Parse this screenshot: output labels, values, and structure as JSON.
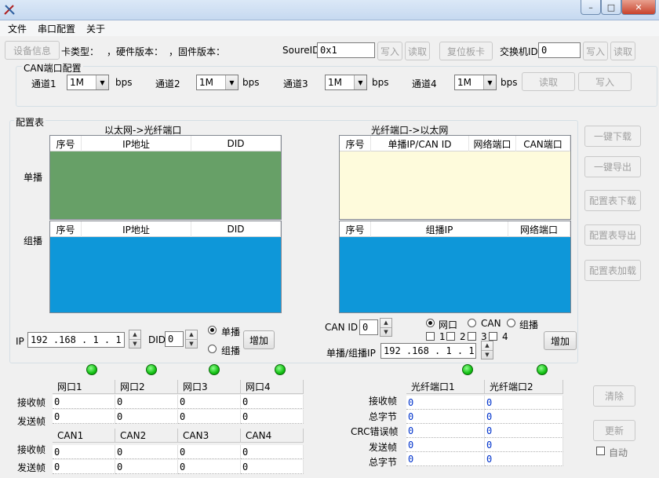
{
  "menu": [
    "文件",
    "串口配置",
    "关于"
  ],
  "device_info_button": "设备信息",
  "card_type_label": "卡类型：",
  "hw_version_label": "，硬件版本：",
  "fw_version_label": "，固件版本：",
  "source_id": {
    "label": "SoureID",
    "value": "0x1",
    "write": "写入",
    "read": "读取"
  },
  "reset_button": "复位板卡",
  "switch_id": {
    "label": "交换机ID",
    "value": "0",
    "write": "写入",
    "read": "读取"
  },
  "can_config": {
    "title": "CAN端口配置",
    "channels": [
      {
        "label": "通道1",
        "value": "1M",
        "unit": "bps"
      },
      {
        "label": "通道2",
        "value": "1M",
        "unit": "bps"
      },
      {
        "label": "通道3",
        "value": "1M",
        "unit": "bps"
      },
      {
        "label": "通道4",
        "value": "1M",
        "unit": "bps"
      }
    ],
    "read": "读取",
    "write": "写入"
  },
  "config_table": {
    "title": "配置表",
    "left_title": "以太网->光纤端口",
    "right_title": "光纤端口->以太网",
    "unicast_label": "单播",
    "multicast_label": "组播",
    "left_unicast_headers": [
      "序号",
      "IP地址",
      "DID"
    ],
    "left_multicast_headers": [
      "序号",
      "IP地址",
      "DID"
    ],
    "right_unicast_headers": [
      "序号",
      "单播IP/CAN ID",
      "网络端口",
      "CAN端口"
    ],
    "right_multicast_headers": [
      "序号",
      "组播IP",
      "网络端口"
    ],
    "colors": {
      "left_unicast_bg": "#67a067",
      "left_multicast_bg": "#0e97d9",
      "right_unicast_bg": "#fefbdc",
      "right_multicast_bg": "#0e97d9"
    }
  },
  "left_controls": {
    "ip_label": "IP",
    "ip_value": "192 .168 .  1  .  1",
    "did_label": "DID",
    "did_value": "0",
    "radio_unicast": "单播",
    "radio_multicast": "组播",
    "add": "增加"
  },
  "right_controls": {
    "can_id_label": "CAN ID",
    "can_id_value": "0",
    "radio_net": "网口",
    "radio_can": "CAN",
    "radio_multicast": "组播",
    "checks": [
      "1",
      "2",
      "3",
      "4"
    ],
    "ip_label": "单播/组播IP",
    "ip_value": "192 .168 .  1  .  1",
    "add": "增加"
  },
  "side_buttons": [
    "一键下载",
    "一键导出",
    "配置表下载",
    "配置表导出",
    "配置表加载"
  ],
  "net_stats": {
    "headers": [
      "网口1",
      "网口2",
      "网口3",
      "网口4"
    ],
    "rows": [
      {
        "label": "接收帧",
        "values": [
          "0",
          "0",
          "0",
          "0"
        ]
      },
      {
        "label": "发送帧",
        "values": [
          "0",
          "0",
          "0",
          "0"
        ]
      }
    ]
  },
  "can_stats": {
    "headers": [
      "CAN1",
      "CAN2",
      "CAN3",
      "CAN4"
    ],
    "rows": [
      {
        "label": "接收帧",
        "values": [
          "0",
          "0",
          "0",
          "0"
        ]
      },
      {
        "label": "发送帧",
        "values": [
          "0",
          "0",
          "0",
          "0"
        ]
      }
    ]
  },
  "fiber_stats": {
    "headers": [
      "光纤端口1",
      "光纤端口2"
    ],
    "rows": [
      {
        "label": "接收帧",
        "values": [
          "0",
          "0"
        ]
      },
      {
        "label": "总字节",
        "values": [
          "0",
          "0"
        ]
      },
      {
        "label": "CRC错误帧",
        "values": [
          "0",
          "0"
        ]
      },
      {
        "label": "发送帧",
        "values": [
          "0",
          "0"
        ]
      },
      {
        "label": "总字节",
        "values": [
          "0",
          "0"
        ]
      }
    ]
  },
  "clear_button": "清除",
  "update_button": "更新",
  "auto_label": "自动"
}
